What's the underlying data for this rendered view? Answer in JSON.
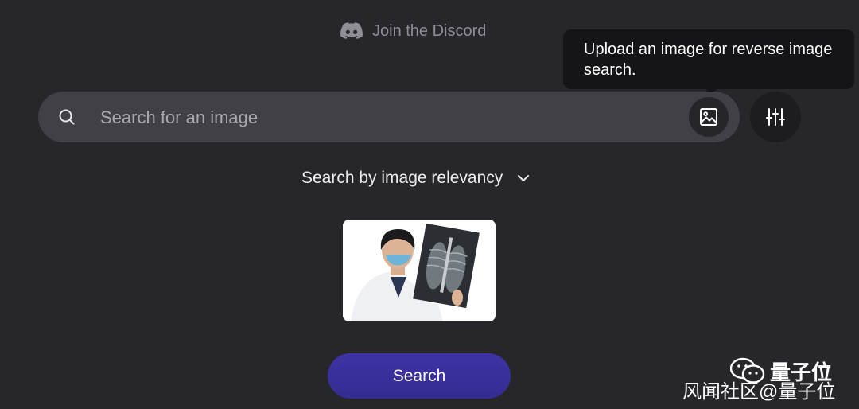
{
  "header": {
    "discord_label": "Join the Discord"
  },
  "search": {
    "placeholder": "Search for an image",
    "value": ""
  },
  "tooltip": {
    "text": "Upload an image for reverse image search."
  },
  "sort": {
    "selected": "Search by image relevancy"
  },
  "actions": {
    "search_label": "Search"
  },
  "watermark": {
    "brand": "量子位",
    "credit": "风闻社区@量子位"
  },
  "colors": {
    "background": "#27262a",
    "search_bar": "#414047",
    "tooltip": "#151417",
    "accent": "#3a30a0",
    "muted_text": "#8f8e94"
  },
  "icons": {
    "discord": "discord-icon",
    "search": "search-icon",
    "image_upload": "image-icon",
    "filters": "sliders-icon",
    "sort": "chevron-down-icon"
  }
}
